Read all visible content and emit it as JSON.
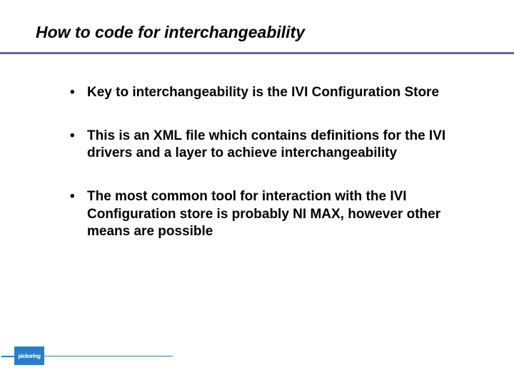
{
  "slide": {
    "title": "How to code for interchangeability",
    "bullets": [
      "Key to interchangeability is the IVI Configuration Store",
      "This is an XML file which contains definitions for the IVI drivers and a layer to achieve interchangeability",
      "The most common tool for interaction with the IVI Configuration store is probably NI MAX, however other means are possible"
    ],
    "logo_text": "pickering"
  }
}
